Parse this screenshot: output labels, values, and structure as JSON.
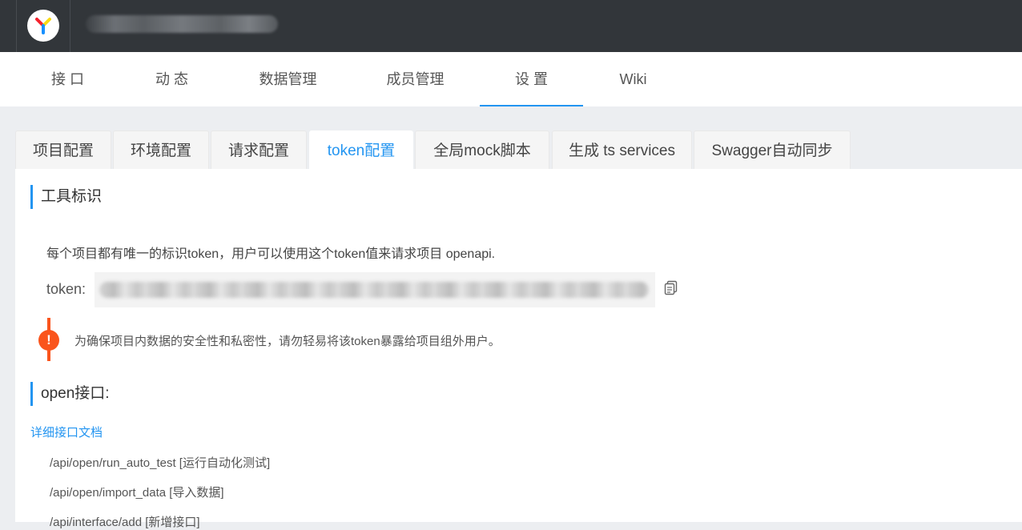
{
  "header": {
    "logo_icon": "yapi-logo-icon",
    "project_name": ""
  },
  "nav": {
    "items": [
      {
        "label": "接 口"
      },
      {
        "label": "动 态"
      },
      {
        "label": "数据管理"
      },
      {
        "label": "成员管理"
      },
      {
        "label": "设 置"
      },
      {
        "label": "Wiki"
      }
    ],
    "active": "设 置"
  },
  "tabs": {
    "items": [
      {
        "label": "项目配置"
      },
      {
        "label": "环境配置"
      },
      {
        "label": "请求配置"
      },
      {
        "label": "token配置"
      },
      {
        "label": "全局mock脚本"
      },
      {
        "label": "生成 ts services"
      },
      {
        "label": "Swagger自动同步"
      }
    ],
    "active": "token配置"
  },
  "token_section": {
    "title": "工具标识",
    "description": "每个项目都有唯一的标识token，用户可以使用这个token值来请求项目 openapi.",
    "token_label": "token:",
    "copy_icon": "copy-icon",
    "warning_icon": "exclamation-icon",
    "warning_text": "为确保项目内数据的安全性和私密性，请勿轻易将该token暴露给项目组外用户。"
  },
  "open_section": {
    "title": "open接口:",
    "doc_link": "详细接口文档",
    "apis": [
      "/api/open/run_auto_test [运行自动化测试]",
      "/api/open/import_data [导入数据]",
      "/api/interface/add [新增接口]"
    ]
  },
  "colors": {
    "accent": "#2395f1",
    "warning": "#fa541c",
    "topbar": "#32363a"
  }
}
